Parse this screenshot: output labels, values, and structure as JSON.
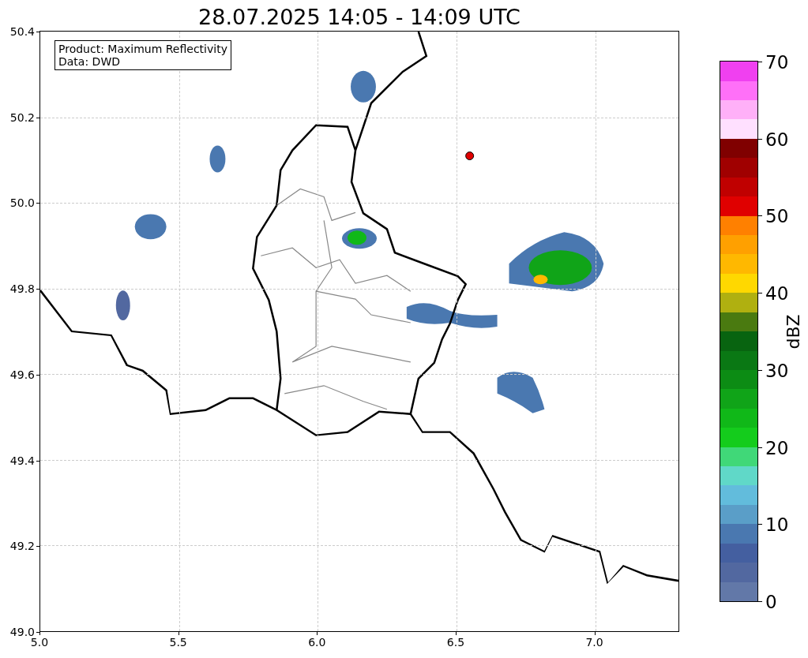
{
  "title": "28.07.2025 14:05 - 14:09 UTC",
  "info_box": {
    "lines": [
      "Product: Maximum Reflectivity",
      "Data: DWD"
    ]
  },
  "map": {
    "y_ticks": [
      "50.4",
      "50.2",
      "50.0",
      "49.8",
      "49.6",
      "49.4",
      "49.2",
      "49.0"
    ],
    "x_ticks": [
      "5.0",
      "5.5",
      "6.0",
      "6.5",
      "7.0"
    ]
  },
  "colorbar": {
    "label": "dBZ",
    "ticks": [
      "70",
      "60",
      "50",
      "40",
      "30",
      "20",
      "10",
      "0"
    ],
    "levels": [
      {
        "color": "#6278a8"
      },
      {
        "color": "#5268a0"
      },
      {
        "color": "#445fa0"
      },
      {
        "color": "#4a78b0"
      },
      {
        "color": "#5a9ec8"
      },
      {
        "color": "#62bcdc"
      },
      {
        "color": "#60d8c8"
      },
      {
        "color": "#40d878"
      },
      {
        "color": "#14cc1c"
      },
      {
        "color": "#10b818"
      },
      {
        "color": "#10a418"
      },
      {
        "color": "#0c8c14"
      },
      {
        "color": "#0a7814"
      },
      {
        "color": "#086410"
      },
      {
        "color": "#4a7a10"
      },
      {
        "color": "#b0b010"
      },
      {
        "color": "#ffd800"
      },
      {
        "color": "#ffb800"
      },
      {
        "color": "#ffa000"
      },
      {
        "color": "#ff8000"
      },
      {
        "color": "#e00000"
      },
      {
        "color": "#c00000"
      },
      {
        "color": "#a00000"
      },
      {
        "color": "#800000"
      },
      {
        "color": "#ffe0ff"
      },
      {
        "color": "#ffb0f8"
      },
      {
        "color": "#ff70f8"
      },
      {
        "color": "#f040f0"
      }
    ]
  }
}
